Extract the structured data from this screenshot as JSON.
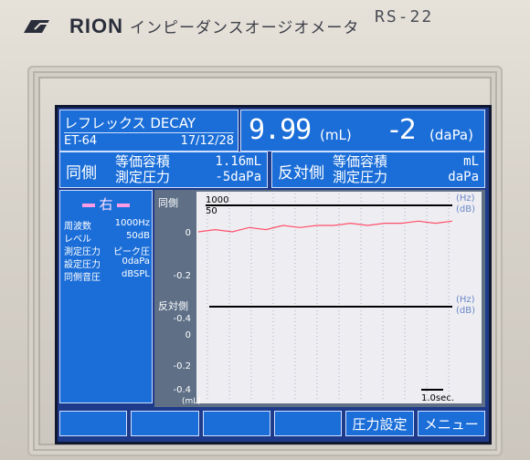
{
  "device": {
    "brand": "RION",
    "model_name": "インピーダンスオージオメータ",
    "model_code": "RS-22"
  },
  "header": {
    "test_name": "レフレックス DECAY",
    "probe": "ET-64",
    "date": "17/12/28",
    "volume_value": "9.99",
    "volume_unit": "(mL)",
    "pressure_value": "-2",
    "pressure_unit": "(daPa)"
  },
  "ipsi": {
    "side_label": "同側",
    "label_volume": "等価容積",
    "label_pressure": "測定圧力",
    "volume_value": "1.16mL",
    "pressure_value": "-5daPa"
  },
  "contra": {
    "side_label": "反対側",
    "label_volume": "等価容積",
    "label_pressure": "測定圧力",
    "volume_value": "mL",
    "pressure_value": "daPa"
  },
  "params": {
    "ear": "右",
    "rows": [
      {
        "label": "周波数",
        "value": "1000Hz"
      },
      {
        "label": "レベル",
        "value": "50dB"
      },
      {
        "label": "測定圧力",
        "value": "ピーク圧"
      },
      {
        "label": "設定圧力",
        "value": "0daPa"
      },
      {
        "label": "同側音圧",
        "value": "dBSPL"
      }
    ]
  },
  "graph": {
    "ipsi_label": "同側",
    "contra_label": "反対側",
    "ipsi_freq": "1000",
    "ipsi_level": "50",
    "hz_unit": "(Hz)",
    "db_unit": "(dB)",
    "y_ticks_ipsi": [
      "0",
      "-0.2",
      "-0.4"
    ],
    "y_ticks_contra": [
      "0",
      "-0.2",
      "-0.4"
    ],
    "y_unit": "(mL)",
    "time_scale": "1.0sec."
  },
  "chart_data": {
    "type": "line",
    "title": "",
    "xlabel": "",
    "ylabel": "(mL)",
    "ylim": [
      -0.4,
      0.05
    ],
    "series": [
      {
        "color": "#ff4f6a",
        "values": [
          0.0,
          0.01,
          0.0,
          0.02,
          0.01,
          0.03,
          0.02,
          0.03,
          0.03,
          0.04,
          0.03,
          0.04,
          0.04,
          0.05,
          0.04,
          0.05
        ]
      }
    ]
  },
  "softkeys": [
    "",
    "",
    "",
    "",
    "圧力設定",
    "メニュー"
  ],
  "colors": {
    "panel": "#1b6ed8",
    "screen_bg": "#1e3a8a",
    "graph_bg": "#5e6f86",
    "trace": "#ff4f6a"
  }
}
